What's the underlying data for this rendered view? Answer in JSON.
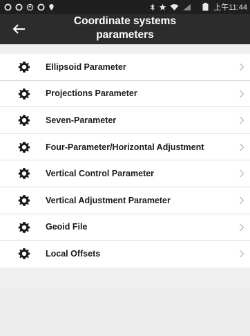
{
  "status_bar": {
    "time": "上午11:44",
    "bg_color": "#1f1f1f",
    "icons": [
      "app-icon",
      "app-icon",
      "sync-icon",
      "app-icon",
      "location-icon",
      "bluetooth-icon",
      "star-icon",
      "wifi-icon",
      "signal-icon",
      "battery-icon"
    ]
  },
  "header": {
    "title": "Coordinate systems parameters",
    "title_line1": "Coordinate systems",
    "title_line2": "parameters",
    "back_icon": "arrow-left-icon",
    "bg_color": "#2c2c2c"
  },
  "menu": {
    "items": [
      {
        "label": "Ellipsoid Parameter",
        "icon": "gear-icon",
        "chevron": "chevron-right-icon"
      },
      {
        "label": "Projections Parameter",
        "icon": "gear-icon",
        "chevron": "chevron-right-icon"
      },
      {
        "label": "Seven-Parameter",
        "icon": "gear-icon",
        "chevron": "chevron-right-icon"
      },
      {
        "label": "Four-Parameter/Horizontal Adjustment",
        "icon": "gear-icon",
        "chevron": "chevron-right-icon"
      },
      {
        "label": "Vertical Control Parameter",
        "icon": "gear-icon",
        "chevron": "chevron-right-icon"
      },
      {
        "label": "Vertical Adjustment Parameter",
        "icon": "gear-icon",
        "chevron": "chevron-right-icon"
      },
      {
        "label": "Geoid File",
        "icon": "gear-icon",
        "chevron": "chevron-right-icon"
      },
      {
        "label": "Local Offsets",
        "icon": "gear-icon",
        "chevron": "chevron-right-icon"
      }
    ]
  }
}
